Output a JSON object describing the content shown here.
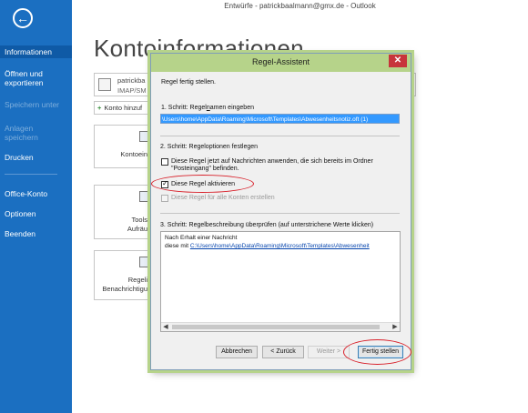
{
  "window": {
    "title": "Entwürfe - patrickbaalmann@gmx.de - Outlook"
  },
  "sidebar": {
    "back_icon": "back-arrow-icon",
    "items": [
      {
        "label": "Informationen",
        "state": "active"
      },
      {
        "label": "Öffnen und exportieren",
        "state": "normal"
      },
      {
        "label": "Speichern unter",
        "state": "disabled"
      },
      {
        "label": "Anlagen speichern",
        "state": "disabled"
      },
      {
        "label": "Drucken",
        "state": "normal"
      },
      {
        "label": "Office-Konto",
        "state": "normal"
      },
      {
        "label": "Optionen",
        "state": "normal"
      },
      {
        "label": "Beenden",
        "state": "normal"
      }
    ]
  },
  "main": {
    "title": "Kontoinformationen",
    "account": {
      "name": "patrickba",
      "type": "IMAP/SM"
    },
    "add_account": "Konto hinzuf",
    "tiles": [
      {
        "label_1": "Kontoein",
        "label_2": ""
      },
      {
        "label_1": "Tools",
        "label_2": "Aufräu"
      },
      {
        "label_1": "Regeli",
        "label_2": "Benachrichtigu"
      }
    ]
  },
  "dialog": {
    "title": "Regel-Assistent",
    "close_icon": "close-icon",
    "finish_text": "Regel fertig stellen.",
    "step1_prefix": "1. Schritt: Regel",
    "step1_underlined": "n",
    "step1_suffix": "amen eingeben",
    "rule_name": "\\Users\\home\\AppData\\Roaming\\Microsoft\\Templates\\Abwesenheitsnotiz.oft (1)",
    "step2_label": "2. Schritt: Regeloptionen festlegen",
    "option_run_now": {
      "label_line1": "Diese Regel jetzt auf Nachrichten anwenden, die sich bereits im Ordner",
      "label_line2": "\"Posteingang\" befinden.",
      "checked": false
    },
    "option_activate": {
      "label": "Diese Regel aktivieren",
      "checked": true
    },
    "option_all_accounts": {
      "label": "Diese Regel für alle Konten erstellen",
      "checked": false,
      "disabled": true
    },
    "step3_label": "3. Schritt: Regelbeschreibung überprüfen (auf unterstrichene Werte klicken)",
    "description": {
      "line1": "Nach Erhalt einer Nachricht",
      "line2_prefix": "diese mit",
      "line2_link": "C:\\Users\\home\\AppData\\Roaming\\Microsoft\\Templates\\Abwesenheit"
    },
    "buttons": {
      "cancel": "Abbrechen",
      "back": "< Zurück",
      "next": "Weiter >",
      "finish": "Fertig stellen"
    },
    "highlight_color": "#d8202a",
    "titlebar_color": "#b6d38a"
  }
}
